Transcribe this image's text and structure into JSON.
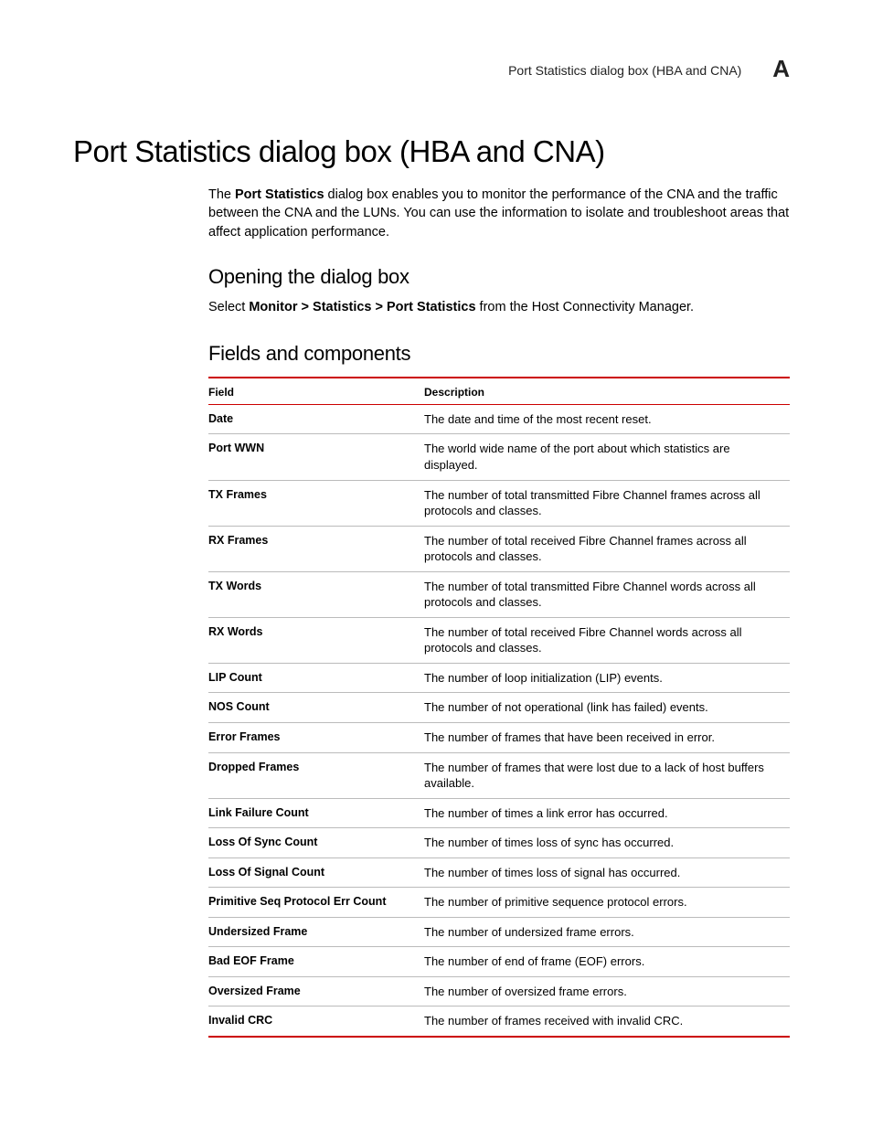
{
  "header": {
    "running_title": "Port Statistics dialog box (HBA and CNA)",
    "appendix_letter": "A"
  },
  "title": "Port Statistics dialog box (HBA and CNA)",
  "intro": {
    "lead_prefix": "The ",
    "lead_bold": "Port Statistics",
    "lead_suffix": " dialog box enables you to monitor the performance of the CNA and the traffic between the CNA and the LUNs. You can use the information to isolate and troubleshoot areas that affect application performance."
  },
  "opening": {
    "heading": "Opening the dialog box",
    "select_label": "Select ",
    "breadcrumb": "Monitor > Statistics > Port Statistics",
    "suffix": " from the Host Connectivity Manager."
  },
  "fields_section": {
    "heading": "Fields and components",
    "col_field": "Field",
    "col_desc": "Description",
    "rows": [
      {
        "field": "Date",
        "desc": "The date and time of the most recent reset."
      },
      {
        "field": "Port WWN",
        "desc": "The world wide name of the port about which statistics are displayed."
      },
      {
        "field": "TX Frames",
        "desc": "The number of total transmitted Fibre Channel frames across all protocols and classes."
      },
      {
        "field": "RX Frames",
        "desc": "The number of total received Fibre Channel frames across all protocols and classes."
      },
      {
        "field": "TX Words",
        "desc": "The number of total transmitted Fibre Channel words across all protocols and classes."
      },
      {
        "field": "RX Words",
        "desc": "The number of total received Fibre Channel words across all protocols and classes."
      },
      {
        "field": "LIP Count",
        "desc": "The number of loop initialization (LIP) events."
      },
      {
        "field": "NOS Count",
        "desc": "The number of not operational (link has failed) events."
      },
      {
        "field": "Error Frames",
        "desc": "The number of frames that have been received in error."
      },
      {
        "field": "Dropped Frames",
        "desc": "The number of frames that were lost due to a lack of host buffers available."
      },
      {
        "field": "Link Failure Count",
        "desc": "The number of times a link error has occurred."
      },
      {
        "field": "Loss Of Sync Count",
        "desc": "The number of times loss of sync has occurred."
      },
      {
        "field": "Loss Of Signal Count",
        "desc": "The number of times loss of signal has occurred."
      },
      {
        "field": "Primitive Seq Protocol Err Count",
        "desc": "The number of primitive sequence protocol errors."
      },
      {
        "field": "Undersized Frame",
        "desc": "The number of undersized frame errors."
      },
      {
        "field": "Bad EOF Frame",
        "desc": "The number of end of frame (EOF) errors."
      },
      {
        "field": "Oversized Frame",
        "desc": "The number of oversized frame errors."
      },
      {
        "field": "Invalid CRC",
        "desc": "The number of frames received with invalid CRC."
      }
    ]
  }
}
